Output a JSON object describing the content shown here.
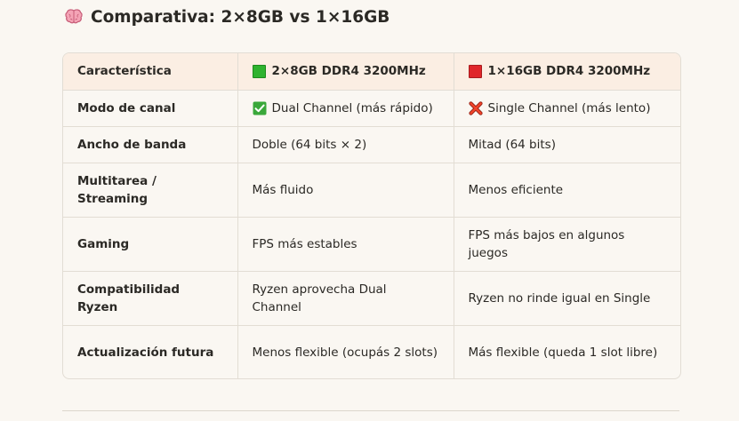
{
  "heading": {
    "icon": "brain-icon",
    "title": "Comparativa: 2×8GB vs 1×16GB"
  },
  "table": {
    "headers": {
      "feature": "Característica",
      "option_a": {
        "icon": "green-square-icon",
        "label": "2×8GB DDR4 3200MHz"
      },
      "option_b": {
        "icon": "red-square-icon",
        "label": "1×16GB DDR4 3200MHz"
      }
    },
    "rows": [
      {
        "feature": "Modo de canal",
        "a": "Dual Channel (más rápido)",
        "a_icon": "check-mark-icon",
        "b": "Single Channel (más lento)",
        "b_icon": "cross-mark-icon"
      },
      {
        "feature": "Ancho de banda",
        "a": "Doble (64 bits × 2)",
        "b": "Mitad (64 bits)"
      },
      {
        "feature": "Multitarea / Streaming",
        "a": "Más fluido",
        "b": "Menos eficiente"
      },
      {
        "feature": "Gaming",
        "a": "FPS más estables",
        "b": "FPS más bajos en algunos juegos"
      },
      {
        "feature": "Compatibilidad Ryzen",
        "a": "Ryzen aprovecha Dual Channel",
        "b": "Ryzen no rinde igual en Single"
      },
      {
        "feature": "Actualización futura",
        "a": "Menos flexible (ocupás 2 slots)",
        "b": "Más flexible (queda 1 slot libre)"
      }
    ]
  },
  "colors": {
    "background": "#faf7f2",
    "header_background": "#fbeee3",
    "border": "#e2ddd4",
    "green": "#2fb32f",
    "red": "#e0262a"
  }
}
